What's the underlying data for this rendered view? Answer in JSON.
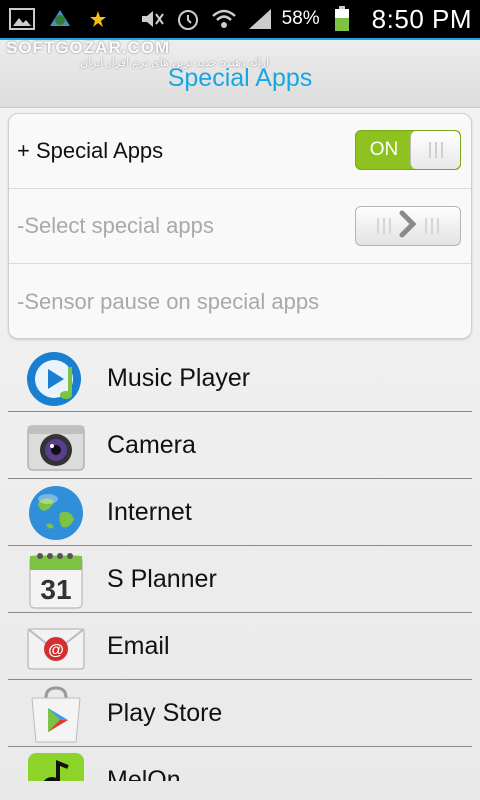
{
  "status_bar": {
    "battery": "58%",
    "time": "8:50 PM",
    "icons": [
      "image-icon",
      "app-notification-icon",
      "star-icon",
      "mute-icon",
      "alarm-icon",
      "wifi-icon",
      "signal-icon",
      "battery-icon"
    ]
  },
  "watermark": {
    "text": "SOFTGOZAR.COM",
    "subtext": "ارائه دهنده جدید ترین های نرم افزار ایران"
  },
  "header": {
    "title": "Special Apps"
  },
  "settings": {
    "special_apps_label": "+ Special Apps",
    "toggle_label": "ON",
    "select_label": "-Select special apps",
    "sensor_label": "-Sensor pause on special apps"
  },
  "apps": [
    {
      "label": "Music Player",
      "icon": "music-player-icon"
    },
    {
      "label": "Camera",
      "icon": "camera-icon"
    },
    {
      "label": "Internet",
      "icon": "internet-globe-icon"
    },
    {
      "label": "S Planner",
      "icon": "calendar-icon",
      "icon_text": "31"
    },
    {
      "label": "Email",
      "icon": "email-icon",
      "icon_text": "@"
    },
    {
      "label": "Play Store",
      "icon": "play-store-icon"
    },
    {
      "label": "MelOn",
      "icon": "melon-icon"
    }
  ],
  "colors": {
    "accent": "#1aa6e0",
    "toggle_on": "#8dc21f",
    "disabled_text": "#a9a9a9"
  }
}
